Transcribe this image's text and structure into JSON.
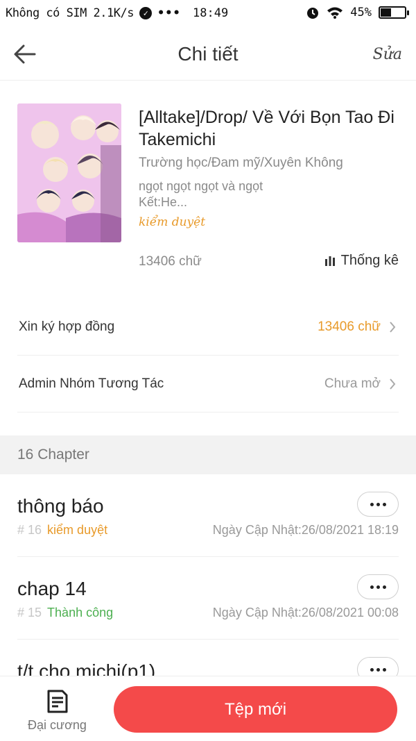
{
  "status_bar": {
    "carrier": "Không có SIM 2.1K/s",
    "time": "18:49",
    "battery_text": "45%",
    "battery_level": 0.45
  },
  "header": {
    "title": "Chi tiết",
    "edit_label": "Sửa"
  },
  "book": {
    "title": "[Alltake]/Drop/ Về Với Bọn Tao Đi Takemichi",
    "genres": "Trường học/Đam mỹ/Xuyên Không",
    "description": "ngọt ngọt ngọt và ngọt\nKết:He...",
    "status": "kiểm duyệt",
    "word_count": "13406 chữ",
    "stats_label": "Thống kê"
  },
  "rows": [
    {
      "label": "Xin ký hợp đồng",
      "value": "13406 chữ",
      "value_color": "#e89a2a"
    },
    {
      "label": "Admin Nhóm Tương Tác",
      "value": "Chưa mở",
      "value_color": "#999999"
    }
  ],
  "chapters_section": {
    "heading": "16 Chapter",
    "items": [
      {
        "title": "thông báo",
        "number": "# 16",
        "status": "kiểm duyệt",
        "status_color": "#e89a2a",
        "date": "Ngày Cập Nhật:26/08/2021 18:19"
      },
      {
        "title": "chap 14",
        "number": "# 15",
        "status": "Thành công",
        "status_color": "#4caf50",
        "date": "Ngày Cập Nhật:26/08/2021 00:08"
      },
      {
        "title": "t/t cho michi(p1)",
        "number": "",
        "status": "",
        "status_color": "#999999",
        "date": ""
      }
    ]
  },
  "bottom_bar": {
    "outline_label": "Đại cương",
    "new_button_label": "Tệp mới"
  },
  "colors": {
    "accent_red": "#f44a4a",
    "review_orange": "#e89a2a",
    "success_green": "#4caf50"
  }
}
